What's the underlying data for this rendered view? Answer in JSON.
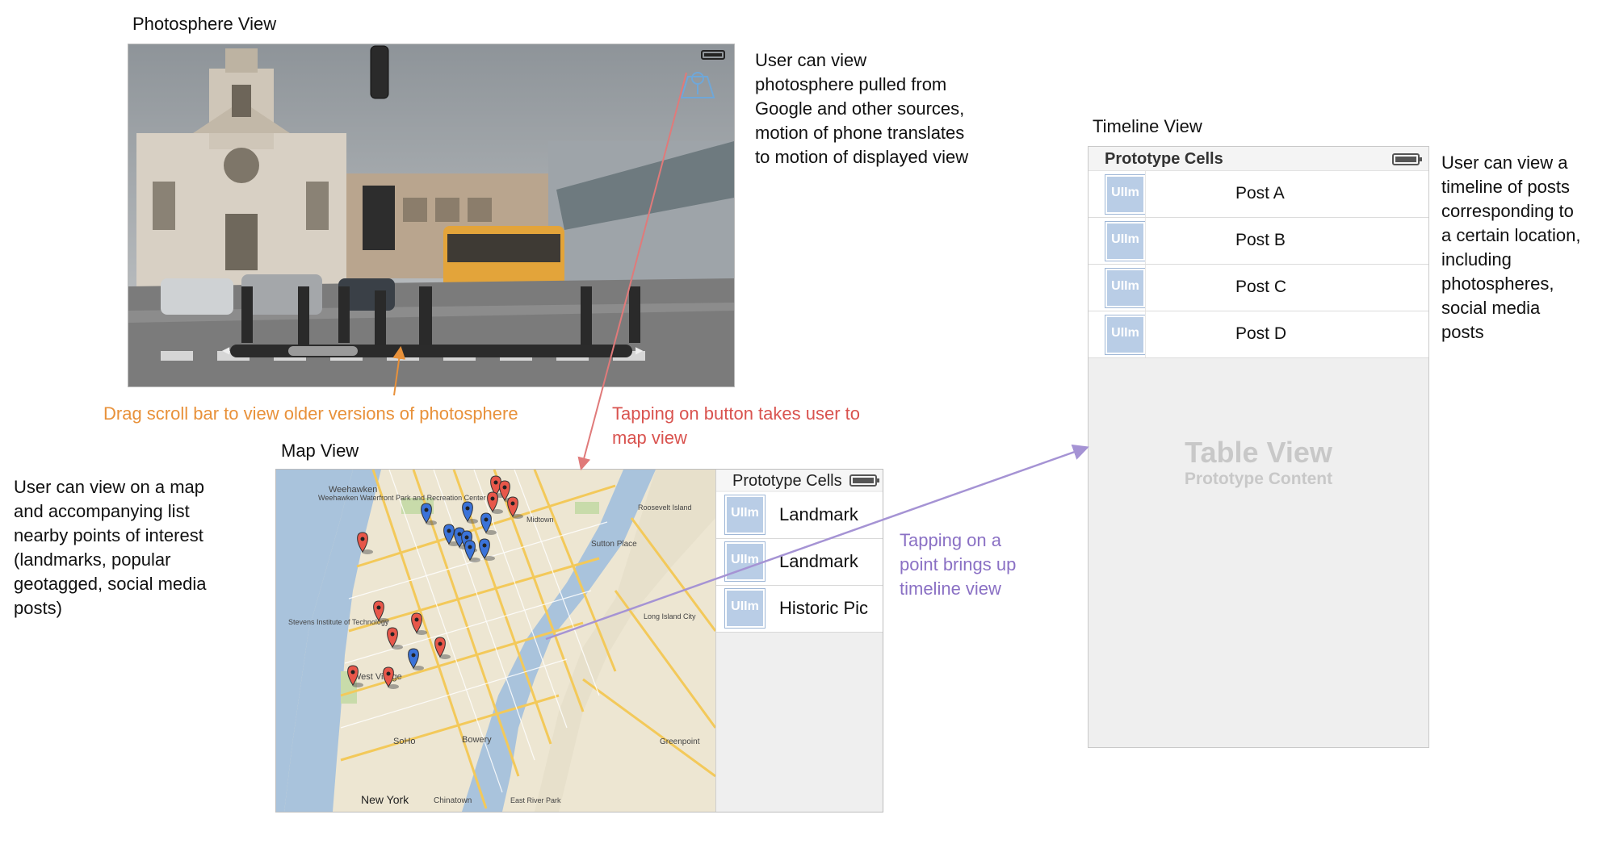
{
  "photosphere": {
    "title": "Photosphere View",
    "description": "User can view\nphotosphere pulled from\nGoogle and other sources,\nmotion of phone translates\nto motion of displayed view",
    "scroll_note": "Drag scroll bar to view older versions of photosphere",
    "button_note": "Tapping on button takes user to\nmap view"
  },
  "timeline": {
    "title": "Timeline View",
    "header": "Prototype Cells",
    "thumb_label": "UIIm",
    "rows": [
      "Post A",
      "Post B",
      "Post C",
      "Post D"
    ],
    "placeholder_title": "Table View",
    "placeholder_sub": "Prototype Content",
    "description": "User can view a\ntimeline of posts\ncorresponding to\na certain location,\nincluding\nphotospheres,\nsocial media\nposts"
  },
  "map": {
    "title": "Map View",
    "description": "User can view on a map\nand accompanying list\nnearby points of interest\n(landmarks, popular\ngeotagged, social media\nposts)",
    "tap_note": "Tapping on a\npoint brings up\ntimeline view",
    "list_header": "Prototype Cells",
    "thumb_label": "UIIm",
    "list_rows": [
      "Landmark",
      "Landmark",
      "Historic Pic"
    ],
    "map_labels": [
      "Weehawken",
      "Weehawken Waterfront Park and Recreation Center",
      "Roosevelt Island",
      "Sutton Place",
      "Stevens Institute of Technology",
      "West Village",
      "SoHo",
      "Bowery",
      "New York",
      "Chinatown",
      "East River Park",
      "Greenpoint",
      "Long Island City",
      "Midtown"
    ]
  },
  "colors": {
    "orange": "#e8913a",
    "red": "#d9534f",
    "purple": "#8a70c4",
    "pin_red": "#e8574a",
    "pin_blue": "#3b73d9"
  }
}
